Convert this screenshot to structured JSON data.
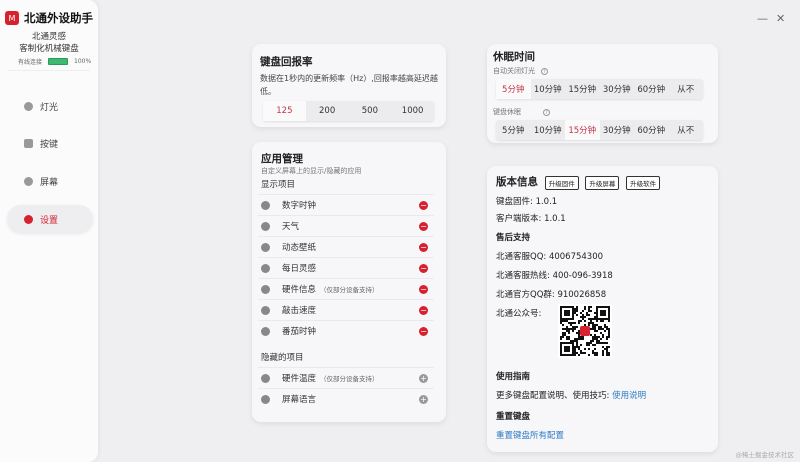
{
  "window": {
    "minimize": "—",
    "close": "✕"
  },
  "sidebar": {
    "logo_mark": "M",
    "app_title": "北通外设助手",
    "device_line1": "北通灵感",
    "device_line2": "客制化机械键盘",
    "connection": "有线连接",
    "battery": "100%",
    "items": [
      {
        "label": "灯光",
        "icon": "bulb-icon"
      },
      {
        "label": "按键",
        "icon": "key-icon"
      },
      {
        "label": "屏幕",
        "icon": "screen-icon"
      },
      {
        "label": "设置",
        "icon": "gear-icon"
      }
    ]
  },
  "report_rate": {
    "title": "键盘回报率",
    "desc": "数据在1秒内的更新频率（Hz）,回报率越高延迟越低。",
    "options": [
      "125",
      "200",
      "500",
      "1000"
    ],
    "selected": "125"
  },
  "apps": {
    "title": "应用管理",
    "subtitle": "自定义屏幕上的显示/隐藏的应用",
    "shown_title": "显示项目",
    "shown": [
      {
        "label": "数字时钟",
        "note": ""
      },
      {
        "label": "天气",
        "note": ""
      },
      {
        "label": "动态壁纸",
        "note": ""
      },
      {
        "label": "每日灵感",
        "note": ""
      },
      {
        "label": "硬件信息",
        "note": "（仅部分设备支持）"
      },
      {
        "label": "敲击速度",
        "note": ""
      },
      {
        "label": "番茄时钟",
        "note": ""
      }
    ],
    "hidden_title": "隐藏的项目",
    "hidden": [
      {
        "label": "硬件温度",
        "note": "（仅部分设备支持）"
      },
      {
        "label": "屏幕语言",
        "note": ""
      }
    ]
  },
  "sleep": {
    "title": "休眠时间",
    "light_label": "自动关闭灯光",
    "light_options": [
      "5分钟",
      "10分钟",
      "15分钟",
      "30分钟",
      "60分钟",
      "从不"
    ],
    "light_selected": "5分钟",
    "kb_label": "键盘休眠",
    "kb_options": [
      "5分钟",
      "10分钟",
      "15分钟",
      "30分钟",
      "60分钟",
      "从不"
    ],
    "kb_selected": "15分钟"
  },
  "version": {
    "title": "版本信息",
    "buttons": [
      "升级固件",
      "升级屏幕",
      "升级软件"
    ],
    "firmware": "键盘固件: 1.0.1",
    "client": "客户端版本: 1.0.1"
  },
  "support": {
    "title": "售后支持",
    "qq": "北通客服QQ:  4006754300",
    "hotline": "北通客服热线:  400-096-3918",
    "group": "北通官方QQ群:  910026858",
    "wechat": "北通公众号:"
  },
  "guide": {
    "title": "使用指南",
    "text": "更多键盘配置说明、使用技巧:",
    "link": "使用说明"
  },
  "reset": {
    "title": "重置键盘",
    "link": "重置键盘所有配置"
  },
  "watermark": "@稀土掘金技术社区"
}
